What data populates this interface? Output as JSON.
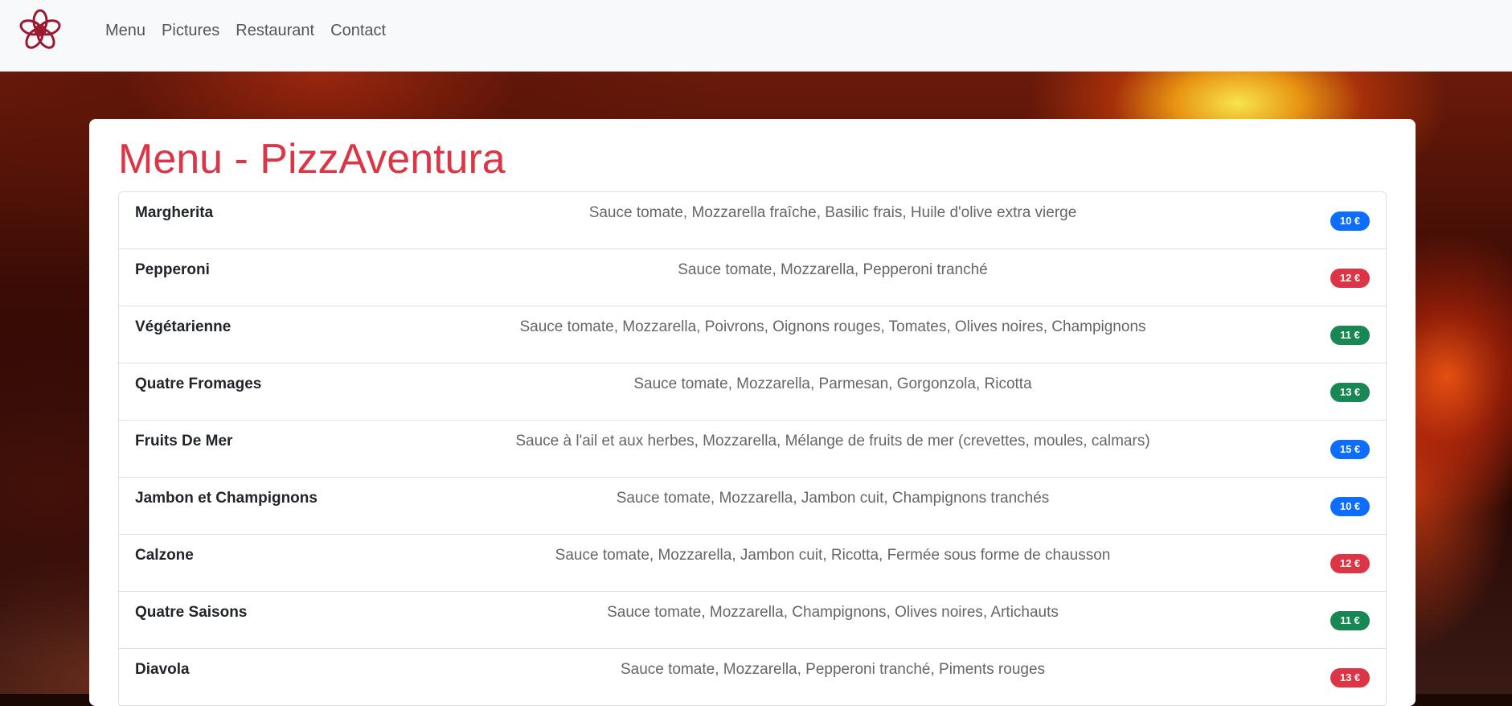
{
  "nav": {
    "logo_icon": "flower-logo-icon",
    "links": [
      "Menu",
      "Pictures",
      "Restaurant",
      "Contact"
    ]
  },
  "colors": {
    "title": "#dc3545",
    "badge_primary": "#0d6efd",
    "badge_danger": "#dc3545",
    "badge_success": "#198754",
    "logo": "#9a1b2f"
  },
  "page": {
    "title": "Menu - PizzAventura"
  },
  "menu": [
    {
      "name": "Margherita",
      "ingredients": "Sauce tomate, Mozzarella fraîche, Basilic frais, Huile d'olive extra vierge",
      "price": "10 €",
      "badge": "primary"
    },
    {
      "name": "Pepperoni",
      "ingredients": "Sauce tomate, Mozzarella, Pepperoni tranché",
      "price": "12 €",
      "badge": "danger"
    },
    {
      "name": "Végétarienne",
      "ingredients": "Sauce tomate, Mozzarella, Poivrons, Oignons rouges, Tomates, Olives noires, Champignons",
      "price": "11 €",
      "badge": "success"
    },
    {
      "name": "Quatre Fromages",
      "ingredients": "Sauce tomate, Mozzarella, Parmesan, Gorgonzola, Ricotta",
      "price": "13 €",
      "badge": "success"
    },
    {
      "name": "Fruits De Mer",
      "ingredients": "Sauce à l'ail et aux herbes, Mozzarella, Mélange de fruits de mer (crevettes, moules, calmars)",
      "price": "15 €",
      "badge": "primary"
    },
    {
      "name": "Jambon et Champignons",
      "ingredients": "Sauce tomate, Mozzarella, Jambon cuit, Champignons tranchés",
      "price": "10 €",
      "badge": "primary"
    },
    {
      "name": "Calzone",
      "ingredients": "Sauce tomate, Mozzarella, Jambon cuit, Ricotta, Fermée sous forme de chausson",
      "price": "12 €",
      "badge": "danger"
    },
    {
      "name": "Quatre Saisons",
      "ingredients": "Sauce tomate, Mozzarella, Champignons, Olives noires, Artichauts",
      "price": "11 €",
      "badge": "success"
    },
    {
      "name": "Diavola",
      "ingredients": "Sauce tomate, Mozzarella, Pepperoni tranché, Piments rouges",
      "price": "13 €",
      "badge": "danger"
    }
  ]
}
